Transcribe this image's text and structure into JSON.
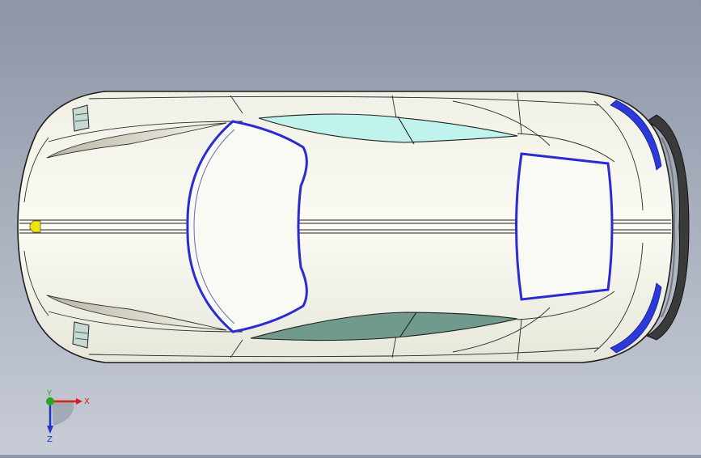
{
  "viewport": {
    "background_top": "#8d95a6",
    "background_bottom": "#c7ccd6"
  },
  "model": {
    "body_color": "#f5f5ec",
    "edge_color": "#1e1e1e",
    "window_outline_color": "#2b2bd6",
    "glass_light_color": "#b9f2ea",
    "glass_dark_color": "#6f9a8c",
    "emblem_color": "#f2e600"
  },
  "triad": {
    "x_label": "X",
    "y_label": "Y",
    "z_label": "Z",
    "x_color": "#e01b1b",
    "y_color": "#1faa1f",
    "z_color": "#2233cc"
  }
}
